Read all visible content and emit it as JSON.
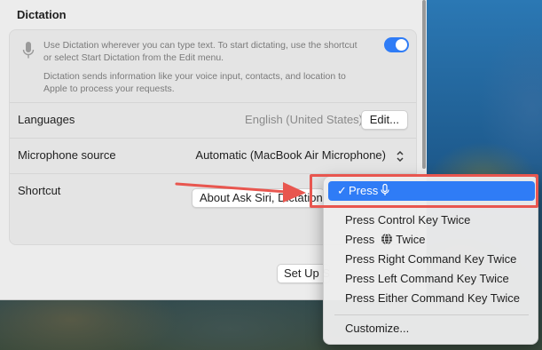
{
  "section": {
    "title": "Dictation"
  },
  "intro": {
    "text1": "Use Dictation wherever you can type text. To start dictating, use the shortcut or select Start Dictation from the Edit menu.",
    "text2": "Dictation sends information like your voice input, contacts, and location to Apple to process your requests.",
    "toggle_on": true
  },
  "rows": {
    "languages": {
      "label": "Languages",
      "value": "English (United States)",
      "button": "Edit..."
    },
    "mic_source": {
      "label": "Microphone source",
      "value": "Automatic (MacBook Air Microphone)"
    },
    "shortcut": {
      "label": "Shortcut"
    }
  },
  "buttons": {
    "about": "About Ask Siri, Dictation & Privacy...",
    "setup": "Set Up Siri..."
  },
  "menu": {
    "selected": {
      "prefix": "✓",
      "label": "Press"
    },
    "items": [
      "Press Control Key Twice",
      "Press",
      "Twice",
      "Press Right Command Key Twice",
      "Press Left Command Key Twice",
      "Press Either Command Key Twice"
    ],
    "customize": "Customize..."
  },
  "colors": {
    "accent": "#2f7cf6",
    "annotation": "#e8564f"
  }
}
